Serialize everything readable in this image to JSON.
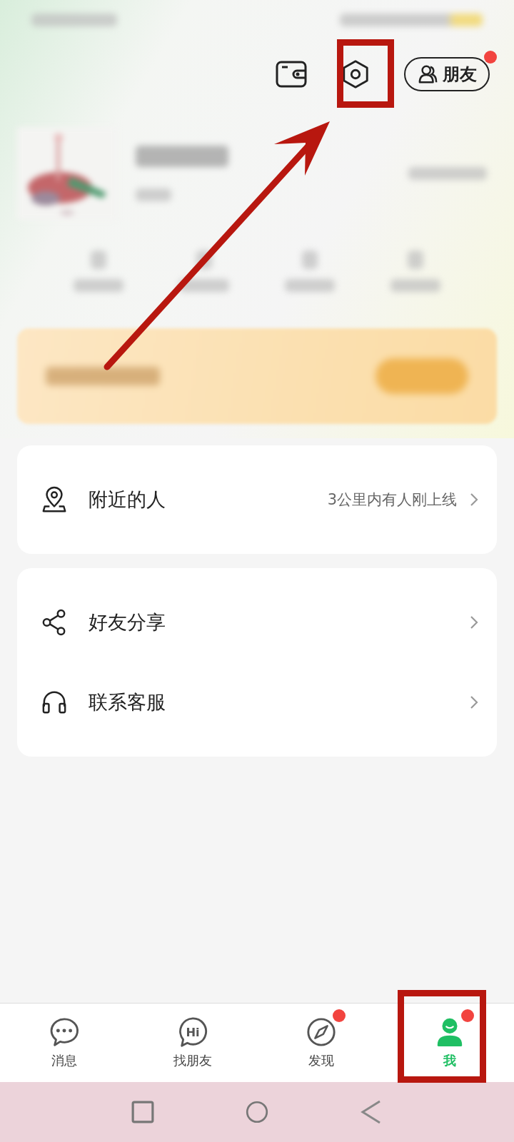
{
  "header": {
    "friends_button": {
      "label": "朋友",
      "badge": true
    }
  },
  "menu_groups": [
    {
      "items": [
        {
          "kind": "location",
          "label": "附近的人",
          "hint": "3公里内有人刚上线"
        }
      ]
    },
    {
      "items": [
        {
          "kind": "share",
          "label": "好友分享"
        },
        {
          "kind": "headset",
          "label": "联系客服"
        }
      ]
    }
  ],
  "tab_bar": [
    {
      "kind": "chat",
      "label": "消息",
      "selected": false,
      "badge": false
    },
    {
      "kind": "hi",
      "label": "找朋友",
      "icon_text": "Hi",
      "selected": false,
      "badge": false
    },
    {
      "kind": "compass",
      "label": "发现",
      "selected": false,
      "badge": true
    },
    {
      "kind": "me",
      "label": "我",
      "selected": true,
      "badge": true
    }
  ]
}
